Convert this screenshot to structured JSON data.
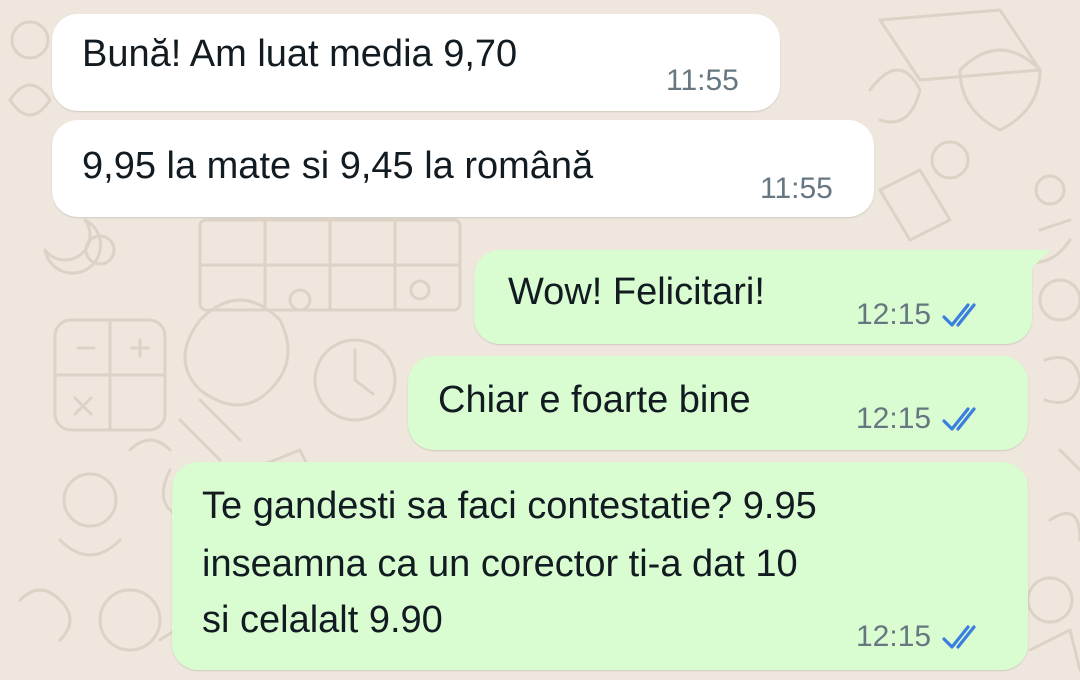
{
  "chat": {
    "colors": {
      "incoming_bubble": "#ffffff",
      "outgoing_bubble": "#dafcd1",
      "read_ticks": "#3a7fe0",
      "wallpaper": "#efe7dd"
    },
    "messages": [
      {
        "direction": "incoming",
        "text": "Bună! Am luat media 9,70",
        "time": "11:55"
      },
      {
        "direction": "incoming",
        "text": "9,95 la mate si 9,45 la română",
        "time": "11:55"
      },
      {
        "direction": "outgoing",
        "text": "Wow! Felicitari!",
        "time": "12:15",
        "status_icon": "double-check-read-icon"
      },
      {
        "direction": "outgoing",
        "text": "Chiar e foarte bine",
        "time": "12:15",
        "status_icon": "double-check-read-icon"
      },
      {
        "direction": "outgoing",
        "text_lines": [
          "Te gandesti sa faci contestatie? 9.95",
          "inseamna ca un corector ti-a dat 10",
          "si celalalt 9.90"
        ],
        "time": "12:15",
        "status_icon": "double-check-read-icon"
      }
    ]
  }
}
